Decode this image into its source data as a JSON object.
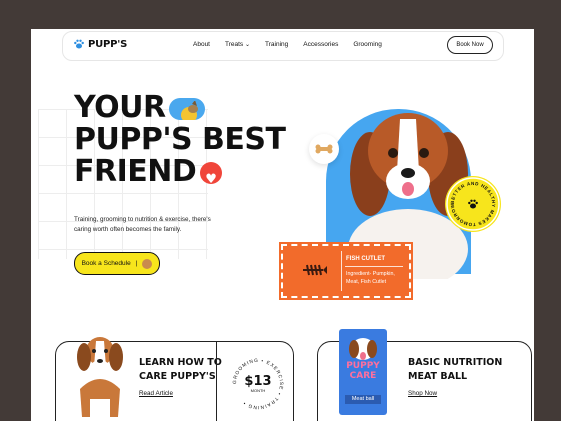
{
  "brand": {
    "name": "PUPP'S"
  },
  "nav": {
    "items": [
      "About",
      "Treats",
      "Training",
      "Accessories",
      "Grooming"
    ],
    "cta": "Book Now"
  },
  "hero": {
    "line1": "YOUR",
    "line2": "PUPP'S BEST",
    "line3": "FRIEND",
    "description": "Training, grooming to nutrition & exercise, there's caring worth often becomes the family.",
    "button": "Book a Schedule"
  },
  "badge": {
    "text": "BETTER AND HEALTHY MAKES TOMORROW"
  },
  "ticket": {
    "title": "FISH CUTLET",
    "ingredients": "Ingredient- Pumpkin, Meat, Fish Cutlet"
  },
  "card1": {
    "title_line1": "LEARN HOW TO",
    "title_line2": "CARE PUPPY'S",
    "link": "Read Article",
    "price": "$13",
    "price_unit": "MONTH",
    "ring_text": "GROOMING • EXERCISE • TRAINING •"
  },
  "card2": {
    "title_line1": "BASIC NUTRITION",
    "title_line2": "MEAT BALL",
    "link": "Shop Now",
    "bag_label": "PUPPY CARE",
    "bag_sub": "Meat ball"
  },
  "colors": {
    "accent_yellow": "#f7e51c",
    "accent_blue": "#46a6f0",
    "accent_orange": "#f26b2b",
    "frame": "#433a37"
  }
}
